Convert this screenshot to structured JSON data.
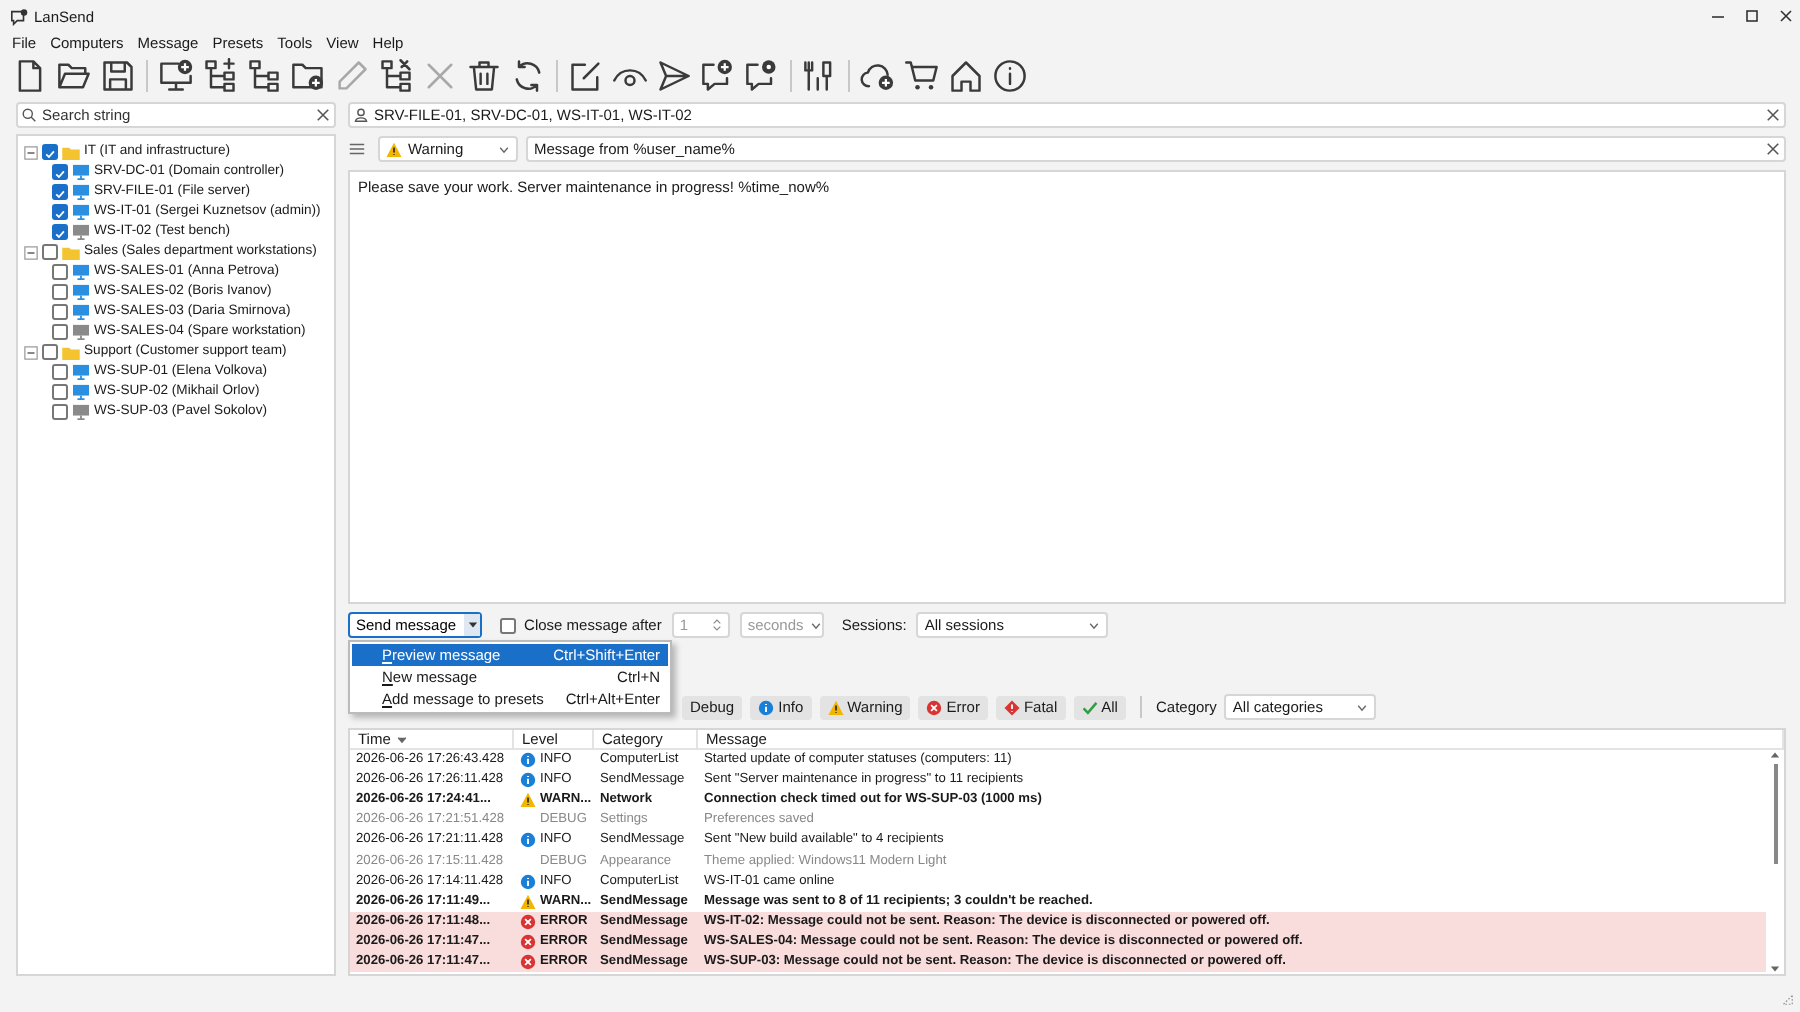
{
  "window": {
    "title": "LanSend"
  },
  "menu": [
    "File",
    "Computers",
    "Message",
    "Presets",
    "Tools",
    "View",
    "Help"
  ],
  "toolbar": [
    [
      {
        "disabled": false
      },
      {
        "disabled": false
      },
      {
        "disabled": false
      }
    ],
    [
      {
        "disabled": false
      },
      {
        "disabled": false
      },
      {
        "disabled": false
      },
      {
        "disabled": false
      },
      {
        "disabled": true
      },
      {
        "disabled": false
      },
      {
        "disabled": true
      },
      {
        "disabled": false
      },
      {
        "disabled": false
      }
    ],
    [
      {
        "disabled": false
      },
      {
        "disabled": false
      },
      {
        "disabled": false
      },
      {
        "disabled": false
      },
      {
        "disabled": false
      }
    ],
    [
      {
        "disabled": false
      }
    ],
    [
      {
        "disabled": false
      },
      {
        "disabled": false
      },
      {
        "disabled": false
      },
      {
        "disabled": false
      }
    ]
  ],
  "sidebar": {
    "search": {
      "placeholder": "Search string"
    },
    "groups": [
      {
        "label": "IT (IT and infrastructure)",
        "expanded": true,
        "checked": true,
        "children": [
          {
            "label": "SRV-DC-01 (Domain controller)",
            "checked": true,
            "online": true
          },
          {
            "label": "SRV-FILE-01 (File server)",
            "checked": true,
            "online": true
          },
          {
            "label": "WS-IT-01 (Sergei Kuznetsov (admin))",
            "checked": true,
            "online": true
          },
          {
            "label": "WS-IT-02 (Test bench)",
            "checked": true,
            "online": false
          }
        ]
      },
      {
        "label": "Sales (Sales department workstations)",
        "expanded": true,
        "checked": false,
        "children": [
          {
            "label": "WS-SALES-01 (Anna Petrova)",
            "checked": false,
            "online": true
          },
          {
            "label": "WS-SALES-02 (Boris Ivanov)",
            "checked": false,
            "online": true
          },
          {
            "label": "WS-SALES-03 (Daria Smirnova)",
            "checked": false,
            "online": true
          },
          {
            "label": "WS-SALES-04 (Spare workstation)",
            "checked": false,
            "online": false
          }
        ]
      },
      {
        "label": "Support (Customer support team)",
        "expanded": true,
        "checked": false,
        "children": [
          {
            "label": "WS-SUP-01 (Elena Volkova)",
            "checked": false,
            "online": true
          },
          {
            "label": "WS-SUP-02 (Mikhail Orlov)",
            "checked": false,
            "online": true
          },
          {
            "label": "WS-SUP-03 (Pavel Sokolov)",
            "checked": false,
            "online": false
          }
        ]
      }
    ]
  },
  "recipients": {
    "value": "SRV-FILE-01, SRV-DC-01, WS-IT-01, WS-IT-02"
  },
  "message": {
    "type": "Warning",
    "subject": "Message from %user_name%",
    "body": "Please save your work. Server maintenance in progress! %time_now%"
  },
  "send_bar": {
    "send_button": "Send message",
    "close_after": {
      "label": "Close message after",
      "checked": false
    },
    "duration": "1",
    "unit": "seconds",
    "sessions_label": "Sessions:",
    "sessions": "All sessions"
  },
  "send_menu": [
    {
      "label": "Preview message",
      "shortcut": "Ctrl+Shift+Enter",
      "selected": true
    },
    {
      "label": "New message",
      "shortcut": "Ctrl+N",
      "selected": false
    },
    {
      "label": "Add message to presets",
      "shortcut": "Ctrl+Alt+Enter",
      "selected": false
    }
  ],
  "log_filters": [
    {
      "label": "Debug",
      "kind": "debug"
    },
    {
      "label": "Info",
      "kind": "info"
    },
    {
      "label": "Warning",
      "kind": "warning"
    },
    {
      "label": "Error",
      "kind": "error"
    },
    {
      "label": "Fatal",
      "kind": "fatal"
    },
    {
      "label": "All",
      "kind": "all"
    }
  ],
  "category_filter": {
    "label": "Category",
    "value": "All categories"
  },
  "log": {
    "columns": [
      {
        "label": "Time",
        "sorted": true
      },
      {
        "label": "Level",
        "sorted": false
      },
      {
        "label": "Category",
        "sorted": false
      },
      {
        "label": "Message",
        "sorted": false
      }
    ],
    "rows": [
      {
        "time": "2026-06-26 17:26:43.428",
        "kind": "info",
        "level_label": "INFO",
        "category": "ComputerList",
        "message": "Started update of computer statuses (computers: 11)"
      },
      {
        "time": "2026-06-26 17:26:11.428",
        "kind": "info",
        "level_label": "INFO",
        "category": "SendMessage",
        "message": "Sent \"Server maintenance in progress\" to 11 recipients"
      },
      {
        "time": "2026-06-26 17:24:41...",
        "kind": "warning",
        "level_label": "WARN...",
        "category": "Network",
        "message": "Connection check timed out for WS-SUP-03 (1000 ms)"
      },
      {
        "time": "2026-06-26 17:21:51.428",
        "kind": "debug",
        "level_label": "DEBUG",
        "category": "Settings",
        "message": "Preferences saved"
      },
      {
        "time": "2026-06-26 17:21:11.428",
        "kind": "info",
        "level_label": "INFO",
        "category": "SendMessage",
        "message": "Sent \"New build available\" to 4 recipients"
      },
      {
        "time": "2026-06-26 17:15:11.428",
        "kind": "debug",
        "level_label": "DEBUG",
        "category": "Appearance",
        "message": "Theme applied: Windows11 Modern Light"
      },
      {
        "time": "2026-06-26 17:14:11.428",
        "kind": "info",
        "level_label": "INFO",
        "category": "ComputerList",
        "message": "WS-IT-01 came online"
      },
      {
        "time": "2026-06-26 17:11:49...",
        "kind": "warning",
        "level_label": "WARN...",
        "category": "SendMessage",
        "message": "Message was sent to 8 of 11 recipients; 3 couldn't be reached."
      },
      {
        "time": "2026-06-26 17:11:48...",
        "kind": "error",
        "level_label": "ERROR",
        "category": "SendMessage",
        "message": "WS-IT-02: Message could not be sent. Reason: The device is disconnected or powered off."
      },
      {
        "time": "2026-06-26 17:11:47...",
        "kind": "error",
        "level_label": "ERROR",
        "category": "SendMessage",
        "message": "WS-SALES-04: Message could not be sent. Reason: The device is disconnected or powered off."
      },
      {
        "time": "2026-06-26 17:11:47...",
        "kind": "error",
        "level_label": "ERROR",
        "category": "SendMessage",
        "message": "WS-SUP-03: Message could not be sent. Reason: The device is disconnected or powered off."
      }
    ]
  }
}
